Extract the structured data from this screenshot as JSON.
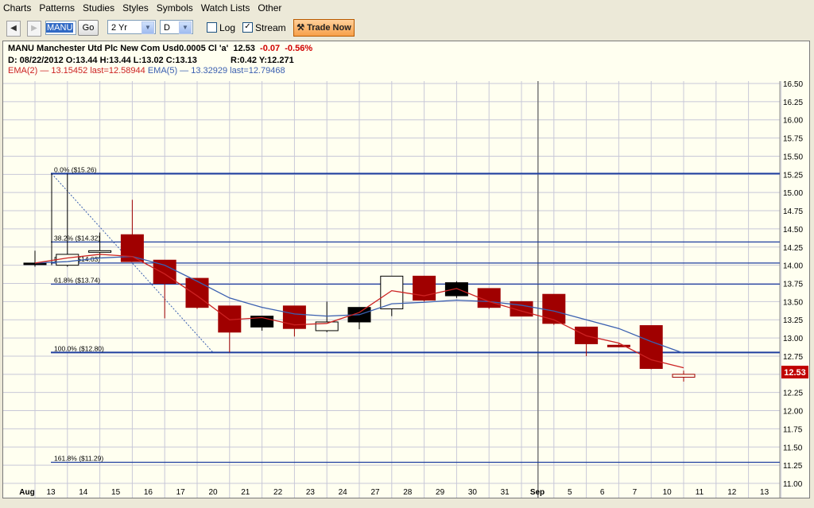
{
  "menu": [
    "Charts",
    "Patterns",
    "Studies",
    "Styles",
    "Symbols",
    "Watch Lists",
    "Other"
  ],
  "toolbar": {
    "symbol": "MANU",
    "go_label": "Go",
    "period": "2 Yr",
    "interval": "D",
    "log_label": "Log",
    "log_checked": false,
    "stream_label": "Stream",
    "stream_checked": true,
    "trade_label": "Trade Now"
  },
  "header": {
    "name": "MANU Manchester Utd Plc New Com Usd0.0005 Cl 'a'",
    "last": "12.53",
    "change": "-0.07",
    "change_pct": "-0.56%",
    "ohlc": "D: 08/22/2012 O:13.44 H:13.44 L:13.02 C:13.13",
    "ry": "R:0.42 Y:12.271",
    "ema2": "EMA(2) — 13.15452 last=12.58944",
    "ema5": "EMA(5) — 13.32929 last=12.79468"
  },
  "price_label": "12.53",
  "chart_data": {
    "type": "candlestick",
    "x_labels": [
      "Aug",
      "13",
      "14",
      "15",
      "16",
      "17",
      "20",
      "21",
      "22",
      "23",
      "24",
      "27",
      "28",
      "29",
      "30",
      "31",
      "Sep",
      "5",
      "6",
      "7",
      "10",
      "11",
      "12",
      "13"
    ],
    "y_ticks": [
      "16.50",
      "16.25",
      "16.00",
      "15.75",
      "15.50",
      "15.25",
      "15.00",
      "14.75",
      "14.50",
      "14.25",
      "14.00",
      "13.75",
      "13.50",
      "13.25",
      "13.00",
      "12.75",
      "12.50",
      "12.25",
      "12.00",
      "11.75",
      "11.50",
      "11.25",
      "11.00"
    ],
    "ylim": [
      11.0,
      16.5
    ],
    "candles": [
      {
        "slot": 0,
        "o": 14.03,
        "h": 14.2,
        "l": 13.98,
        "c": 14.03
      },
      {
        "slot": 1,
        "o": 14.0,
        "h": 15.26,
        "l": 13.98,
        "c": 14.15
      },
      {
        "slot": 2,
        "o": 14.2,
        "h": 14.45,
        "l": 14.1,
        "c": 14.2
      },
      {
        "slot": 3,
        "o": 14.42,
        "h": 14.9,
        "l": 14.05,
        "c": 14.05
      },
      {
        "slot": 4,
        "o": 14.07,
        "h": 14.07,
        "l": 13.27,
        "c": 13.75
      },
      {
        "slot": 5,
        "o": 13.82,
        "h": 13.82,
        "l": 13.4,
        "c": 13.42
      },
      {
        "slot": 6,
        "o": 13.44,
        "h": 13.44,
        "l": 12.8,
        "c": 13.08
      },
      {
        "slot": 7,
        "o": 13.15,
        "h": 13.3,
        "l": 13.1,
        "c": 13.3
      },
      {
        "slot": 8,
        "o": 13.44,
        "h": 13.44,
        "l": 13.02,
        "c": 13.13
      },
      {
        "slot": 9,
        "o": 13.1,
        "h": 13.5,
        "l": 13.08,
        "c": 13.22
      },
      {
        "slot": 10,
        "o": 13.22,
        "h": 13.42,
        "l": 13.12,
        "c": 13.42
      },
      {
        "slot": 11,
        "o": 13.4,
        "h": 13.85,
        "l": 13.3,
        "c": 13.85
      },
      {
        "slot": 12,
        "o": 13.85,
        "h": 13.85,
        "l": 13.5,
        "c": 13.52
      },
      {
        "slot": 13,
        "o": 13.58,
        "h": 13.78,
        "l": 13.55,
        "c": 13.76
      },
      {
        "slot": 14,
        "o": 13.68,
        "h": 13.68,
        "l": 13.4,
        "c": 13.42
      },
      {
        "slot": 15,
        "o": 13.5,
        "h": 13.5,
        "l": 13.3,
        "c": 13.3
      },
      {
        "slot": 16,
        "o": 13.6,
        "h": 13.6,
        "l": 13.18,
        "c": 13.2
      },
      {
        "slot": 17,
        "o": 13.15,
        "h": 13.15,
        "l": 12.75,
        "c": 12.92
      },
      {
        "slot": 18,
        "o": 12.9,
        "h": 12.92,
        "l": 12.87,
        "c": 12.88
      },
      {
        "slot": 19,
        "o": 13.17,
        "h": 13.17,
        "l": 12.57,
        "c": 12.58
      },
      {
        "slot": 20,
        "o": 12.5,
        "h": 12.55,
        "l": 12.4,
        "c": 12.46
      }
    ],
    "ema2": [
      [
        0,
        14.03
      ],
      [
        1,
        14.1
      ],
      [
        2,
        14.15
      ],
      [
        3,
        14.12
      ],
      [
        4,
        13.88
      ],
      [
        5,
        13.58
      ],
      [
        6,
        13.25
      ],
      [
        7,
        13.28
      ],
      [
        8,
        13.18
      ],
      [
        9,
        13.2
      ],
      [
        10,
        13.35
      ],
      [
        11,
        13.65
      ],
      [
        12,
        13.58
      ],
      [
        13,
        13.68
      ],
      [
        14,
        13.5
      ],
      [
        15,
        13.37
      ],
      [
        16,
        13.25
      ],
      [
        17,
        13.03
      ],
      [
        18,
        12.93
      ],
      [
        19,
        12.7
      ],
      [
        20,
        12.59
      ]
    ],
    "ema5": [
      [
        0,
        14.03
      ],
      [
        1,
        14.05
      ],
      [
        2,
        14.1
      ],
      [
        3,
        14.12
      ],
      [
        4,
        14.0
      ],
      [
        5,
        13.78
      ],
      [
        6,
        13.55
      ],
      [
        7,
        13.42
      ],
      [
        8,
        13.33
      ],
      [
        9,
        13.3
      ],
      [
        10,
        13.32
      ],
      [
        11,
        13.47
      ],
      [
        12,
        13.49
      ],
      [
        13,
        13.52
      ],
      [
        14,
        13.5
      ],
      [
        15,
        13.45
      ],
      [
        16,
        13.37
      ],
      [
        17,
        13.25
      ],
      [
        18,
        13.13
      ],
      [
        19,
        12.95
      ],
      [
        20,
        12.79
      ]
    ],
    "fib_levels": [
      {
        "label": "0.0% ($15.26)",
        "value": 15.26
      },
      {
        "label": "38.2% ($14.32)",
        "value": 14.32
      },
      {
        "label": "50.0% ($14.03)",
        "value": 14.03
      },
      {
        "label": "61.8% ($13.74)",
        "value": 13.74
      },
      {
        "label": "100.0% ($12.80)",
        "value": 12.8
      },
      {
        "label": "161.8% ($11.29)",
        "value": 11.29
      }
    ],
    "colors": {
      "down": "#a00000",
      "up": "#000000",
      "ema2": "#cc2222",
      "ema5": "#3a5fb0",
      "fib": "#1f3f9f",
      "grid": "#c8c8d8"
    }
  }
}
